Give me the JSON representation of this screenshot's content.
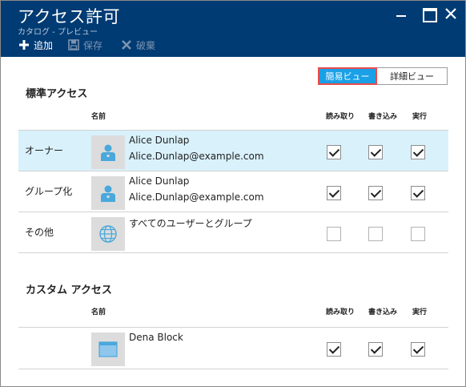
{
  "window": {
    "title": "アクセス許可",
    "subtitle": "カタログ - プレビュー"
  },
  "toolbar": {
    "add_label": "追加",
    "save_label": "保存",
    "discard_label": "破棄"
  },
  "view_toggle": {
    "simple_label": "簡易ビュー",
    "detail_label": "詳細ビュー",
    "selected": "簡易ビュー"
  },
  "columns": {
    "name": "名前",
    "read": "読み取り",
    "write": "書き込み",
    "execute": "実行"
  },
  "standard_access": {
    "title": "標準アクセス",
    "rows": [
      {
        "label": "オーナー",
        "name": "Alice Dunlap",
        "email": "Alice.Dunlap@example.com",
        "avatar_icon": "user-icon",
        "read": true,
        "write": true,
        "execute": true,
        "selected": true
      },
      {
        "label": "グループ化",
        "name": "Alice Dunlap",
        "email": "Alice.Dunlap@example.com",
        "avatar_icon": "user-icon",
        "read": true,
        "write": true,
        "execute": true,
        "selected": false
      },
      {
        "label": "その他",
        "name": "すべてのユーザーとグループ",
        "email": "",
        "avatar_icon": "globe-icon",
        "read": false,
        "write": false,
        "execute": false,
        "selected": false
      }
    ]
  },
  "custom_access": {
    "title": "カスタム アクセス",
    "rows": [
      {
        "label": "",
        "name": "Dena Block",
        "avatar_icon": "window-icon",
        "read": true,
        "write": true,
        "execute": true
      }
    ]
  },
  "colors": {
    "titlebar": "#003b73",
    "accent": "#1aa0e6",
    "highlight_border": "#e84c4c",
    "selected_row": "#d9f1fb"
  }
}
